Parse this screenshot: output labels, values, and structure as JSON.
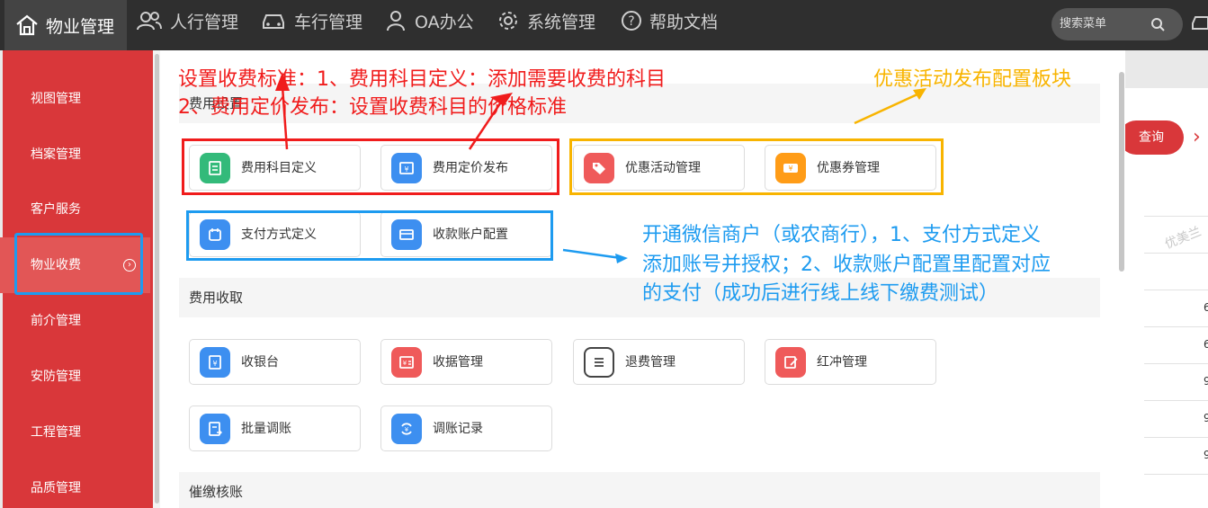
{
  "topnav": [
    {
      "label": "物业管理",
      "icon": "home-icon"
    },
    {
      "label": "人行管理",
      "icon": "users-icon"
    },
    {
      "label": "车行管理",
      "icon": "car-icon"
    },
    {
      "label": "OA办公",
      "icon": "person-icon"
    },
    {
      "label": "系统管理",
      "icon": "gear-icon"
    },
    {
      "label": "帮助文档",
      "icon": "help-icon"
    }
  ],
  "search": {
    "placeholder": "搜索菜单"
  },
  "sidebar": [
    {
      "label": "视图管理"
    },
    {
      "label": "档案管理"
    },
    {
      "label": "客户服务"
    },
    {
      "label": "物业收费",
      "active": true
    },
    {
      "label": "前介管理"
    },
    {
      "label": "安防管理"
    },
    {
      "label": "工程管理"
    },
    {
      "label": "品质管理"
    }
  ],
  "sections": {
    "setup": "费用设置",
    "collect": "费用收取",
    "dunning": "催缴核账"
  },
  "cards": {
    "fee_subject": "费用科目定义",
    "fee_pricing": "费用定价发布",
    "promo_activity": "优惠活动管理",
    "coupon": "优惠券管理",
    "pay_method": "支付方式定义",
    "collect_account": "收款账户配置",
    "cashier": "收银台",
    "receipt": "收据管理",
    "refund": "退费管理",
    "red_reverse": "红冲管理",
    "batch_adjust": "批量调账",
    "adjust_record": "调账记录"
  },
  "background": {
    "query_button": "查询",
    "watermark": "优美兰",
    "digits": [
      "6",
      "6",
      "9",
      "9",
      "9"
    ]
  },
  "annotations": {
    "red_line1": "设置收费标准：1、费用科目定义：添加需要收费的科目",
    "red_line2": "2、费用定价发布：设置收费科目的价格标准",
    "orange": "优惠活动发布配置板块",
    "blue_line1": "开通微信商户（或农商行），1、支付方式定义",
    "blue_line2": "添加账号并授权；2、收款账户配置里配置对应",
    "blue_line3": "的支付（成功后进行线上线下缴费测试）"
  },
  "colors": {
    "sidebar": "#d9373a",
    "red_annotation": "#f01c1c",
    "orange_annotation": "#f8b400",
    "blue_annotation": "#1d9bf0"
  }
}
